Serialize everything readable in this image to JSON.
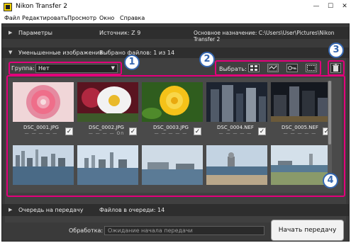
{
  "window": {
    "title": "Nikon Transfer 2",
    "controls": {
      "minimize": "—",
      "maximize": "☐",
      "close": "✕"
    }
  },
  "menu": [
    "Файл",
    "Редактировать",
    "Просмотр",
    "Окно",
    "Справка"
  ],
  "params": {
    "label": "Параметры",
    "source": "Источник: Z 9",
    "destination": "Основное назначение: C:\\Users\\User\\Pictures\\Nikon Transfer 2"
  },
  "thumbs_section": {
    "label": "Уменьшенные изображения",
    "selected": "Выбрано файлов: 1 из 14",
    "group_label": "Группа:",
    "group_value": "Нет",
    "select_label": "Выбрать:"
  },
  "thumbnails": [
    {
      "name": "DSC_0001.JPG",
      "checked": true,
      "marks": "— — — — —",
      "kind": "dahlia"
    },
    {
      "name": "DSC_0002.JPG",
      "checked": true,
      "marks": "— — — — Оп",
      "kind": "daisy"
    },
    {
      "name": "DSC_0003.JPG",
      "checked": true,
      "marks": "— — — — —",
      "kind": "rose"
    },
    {
      "name": "DSC_0004.NEF",
      "checked": true,
      "marks": "— — — — —",
      "kind": "city-dark"
    },
    {
      "name": "DSC_0005.NEF",
      "checked": true,
      "marks": "— — — — —",
      "kind": "city-dark2"
    },
    {
      "kind": "skyline"
    },
    {
      "kind": "skyline2"
    },
    {
      "kind": "river"
    },
    {
      "kind": "park"
    },
    {
      "kind": "park2"
    }
  ],
  "queue": {
    "label": "Очередь на передачу",
    "count": "Файлов в очереди: 14"
  },
  "processing": {
    "label": "Обработка:",
    "status": "Ожидание начала передачи",
    "start_button": "Начать передачу"
  },
  "callouts": [
    "1",
    "2",
    "3",
    "4"
  ],
  "colors": {
    "callout_border": "#e3007b",
    "badge": "#3567b1",
    "background": "#3a3a3a"
  }
}
